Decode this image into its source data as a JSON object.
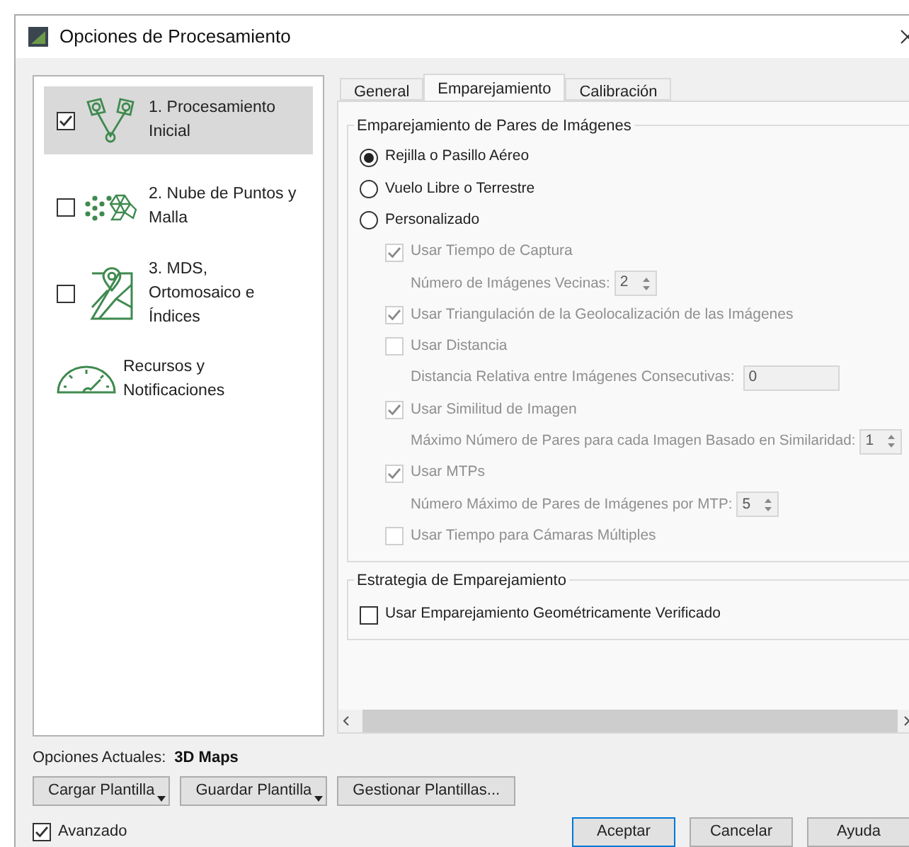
{
  "window": {
    "title": "Opciones de Procesamiento"
  },
  "steps": [
    {
      "kind": "initial",
      "label": "1. Procesamiento Inicial",
      "checked": true,
      "selected": true
    },
    {
      "kind": "cloud",
      "label": "2. Nube de Puntos y Malla",
      "checked": false,
      "selected": false
    },
    {
      "kind": "map",
      "label": "3. MDS, Ortomosaico e Índices",
      "checked": false,
      "selected": false
    },
    {
      "kind": "resources",
      "label": "Recursos y Notificaciones",
      "selected": false
    }
  ],
  "tabs": [
    {
      "label": "General",
      "selected": false
    },
    {
      "label": "Emparejamiento",
      "selected": true
    },
    {
      "label": "Calibración",
      "selected": false
    }
  ],
  "groups": [
    {
      "title": "Emparejamiento de Pares de Imágenes",
      "options": [
        {
          "kind": "radio",
          "label": "Rejilla o Pasillo Aéreo",
          "selected": true
        },
        {
          "kind": "radio",
          "label": "Vuelo Libre o Terrestre",
          "selected": false
        },
        {
          "kind": "radio",
          "label": "Personalizado",
          "selected": false,
          "children": [
            {
              "kind": "checkbox",
              "label": "Usar Tiempo de Captura",
              "checked": true,
              "disabled": true,
              "children": [
                {
                  "kind": "spin",
                  "label": "Número de Imágenes Vecinas:",
                  "value": "2",
                  "disabled": true
                }
              ]
            },
            {
              "kind": "checkbox",
              "label": "Usar Triangulación de la Geolocalización de las Imágenes",
              "checked": true,
              "disabled": true
            },
            {
              "kind": "checkbox",
              "label": "Usar Distancia",
              "checked": false,
              "disabled": true,
              "children": [
                {
                  "kind": "field",
                  "label": "Distancia Relativa entre Imágenes Consecutivas:",
                  "value": "0",
                  "disabled": true
                }
              ]
            },
            {
              "kind": "checkbox",
              "label": "Usar Similitud de Imagen",
              "checked": true,
              "disabled": true,
              "children": [
                {
                  "kind": "spin",
                  "label": "Máximo Número de Pares para cada Imagen Basado en Similaridad:",
                  "value": "1",
                  "disabled": true
                }
              ]
            },
            {
              "kind": "checkbox",
              "label": "Usar MTPs",
              "checked": true,
              "disabled": true,
              "children": [
                {
                  "kind": "spin",
                  "label": "Número Máximo de Pares de Imágenes por MTP:",
                  "value": "5",
                  "disabled": true
                }
              ]
            },
            {
              "kind": "checkbox",
              "label": "Usar Tiempo para Cámaras Múltiples",
              "checked": false,
              "disabled": true
            }
          ]
        }
      ]
    },
    {
      "title": "Estrategia de Emparejamiento",
      "options": [
        {
          "kind": "checkbox",
          "label": "Usar Emparejamiento Geométricamente Verificado",
          "checked": false,
          "disabled": false
        }
      ]
    }
  ],
  "current": {
    "label": "Opciones Actuales:",
    "value": "3D Maps"
  },
  "template_buttons": [
    {
      "kind": "dropdown",
      "label": "Cargar Plantilla"
    },
    {
      "kind": "dropdown",
      "label": "Guardar Plantilla"
    },
    {
      "kind": "plain",
      "label": "Gestionar Plantillas..."
    }
  ],
  "advanced": {
    "label": "Avanzado",
    "checked": true
  },
  "buttons": [
    {
      "label": "Aceptar",
      "default": true
    },
    {
      "label": "Cancelar",
      "default": false
    },
    {
      "label": "Ayuda",
      "default": false
    }
  ]
}
